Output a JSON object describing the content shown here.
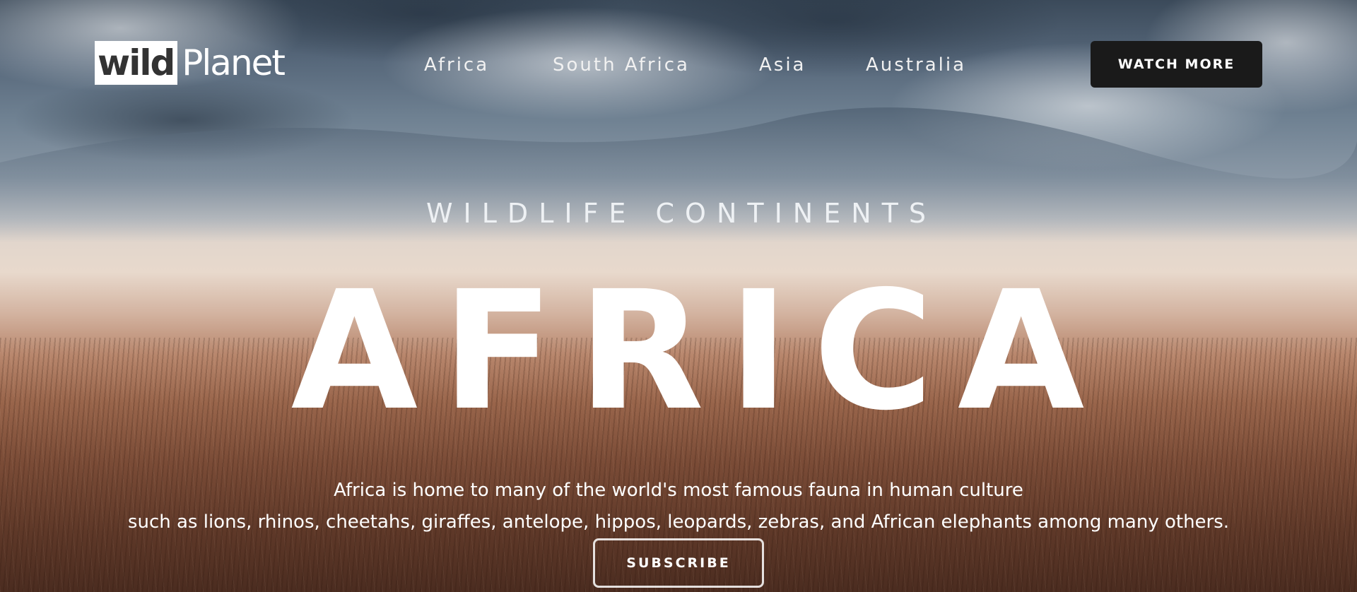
{
  "logo": {
    "box_text": "wild",
    "text": "Planet"
  },
  "nav": {
    "items": [
      {
        "label": "Africa"
      },
      {
        "label": "South Africa"
      },
      {
        "label": "Asia"
      },
      {
        "label": "Australia"
      }
    ]
  },
  "header": {
    "cta_label": "WATCH MORE"
  },
  "hero": {
    "subtitle": "WILDLIFE CONTINENTS",
    "headline": "AFRICA",
    "description_line1": "Africa is home to many of the world's most famous fauna in human culture",
    "description_line2": "such as lions, rhinos, cheetahs, giraffes, antelope, hippos, leopards, zebras, and African elephants among many others.",
    "subscribe_label": "SUBSCRIBE"
  },
  "colors": {
    "cta_background": "#1a1a1a",
    "text": "#ffffff"
  }
}
